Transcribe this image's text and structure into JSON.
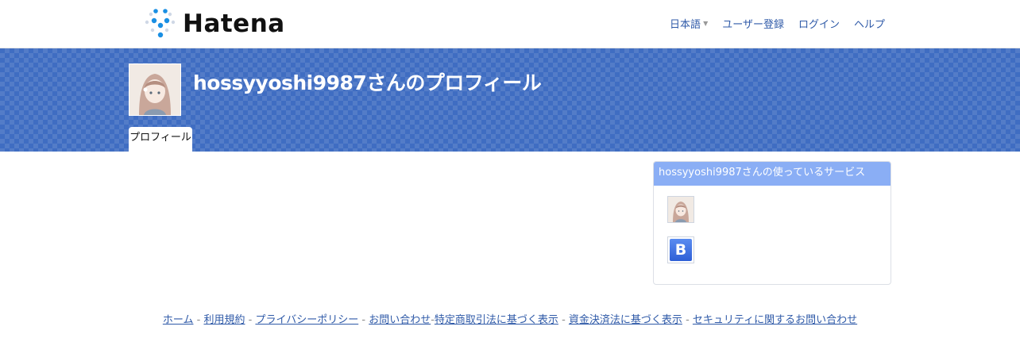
{
  "header": {
    "logo_text": "Hatena",
    "nav": {
      "language": "日本語",
      "register": "ユーザー登録",
      "login": "ログイン",
      "help": "ヘルプ"
    }
  },
  "profile": {
    "title": "hossyyoshi9987さんのプロフィール",
    "tab_label": "プロフィール"
  },
  "services": {
    "header": "hossyyoshi9987さんの使っているサービス",
    "items": [
      {
        "name": "profile",
        "icon": "avatar-icon"
      },
      {
        "name": "bookmark",
        "icon": "hatena-bookmark-icon",
        "label": "B"
      }
    ]
  },
  "footer": {
    "links": [
      "ホーム",
      "利用規約",
      "プライバシーポリシー",
      "お問い合わせ",
      "特定商取引法に基づく表示",
      "資金決済法に基づく表示",
      "セキュリティに関するお問い合わせ"
    ],
    "separator": "-"
  },
  "colors": {
    "banner": "#3f6dc2",
    "services_header": "#8aaef5",
    "link": "#2f5aa8"
  }
}
